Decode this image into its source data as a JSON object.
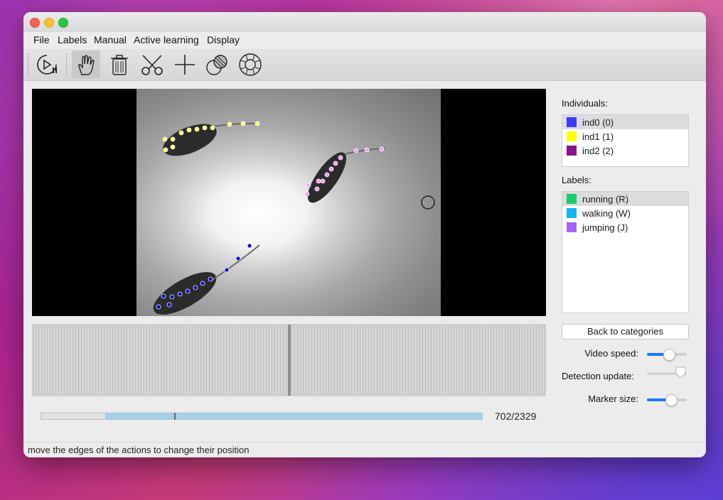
{
  "menu": [
    "File",
    "Labels",
    "Manual",
    "Active learning",
    "Display"
  ],
  "toolbar": {
    "buttons": [
      {
        "icon": "play-pause-icon"
      },
      {
        "icon": "hand-icon",
        "active": true
      },
      {
        "icon": "trash-icon"
      },
      {
        "icon": "scissors-icon"
      },
      {
        "icon": "plus-icon"
      },
      {
        "icon": "ball-icon"
      },
      {
        "icon": "lifebuoy-icon"
      }
    ]
  },
  "individuals": {
    "title": "Individuals:",
    "items": [
      {
        "label": "ind0 (0)",
        "color": "#3c3cff",
        "selected": true
      },
      {
        "label": "ind1 (1)",
        "color": "#ffff00",
        "selected": false
      },
      {
        "label": "ind2 (2)",
        "color": "#8b0f8f",
        "selected": false
      }
    ]
  },
  "labels": {
    "title": "Labels:",
    "items": [
      {
        "label": "running (R)",
        "color": "#17cc6b",
        "selected": true
      },
      {
        "label": "walking (W)",
        "color": "#12b5f5",
        "selected": false
      },
      {
        "label": "jumping (J)",
        "color": "#a765f5",
        "selected": false
      }
    ]
  },
  "back_button": "Back to categories",
  "sliders": {
    "video_speed": {
      "label": "Video speed:",
      "value": 0.55
    },
    "detection_update": {
      "label": "Detection update:",
      "value": 0.85
    },
    "marker_size": {
      "label": "Marker size:",
      "value": 0.6
    }
  },
  "progress": {
    "window_start": 0.145,
    "window_end": 1.0,
    "cursor": 0.301
  },
  "frame_counter": "702/2329",
  "status": "move the edges of the actions to change their position",
  "colors": {
    "ind0": "#0000cc",
    "ind1": "#ffff66",
    "ind2": "#ff99ff"
  }
}
